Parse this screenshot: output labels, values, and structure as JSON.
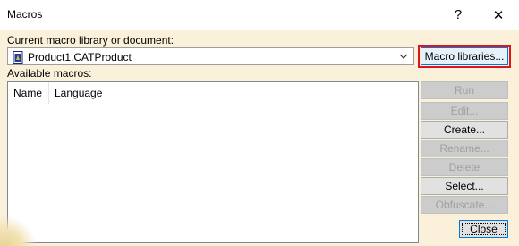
{
  "window": {
    "title": "Macros",
    "help_glyph": "?",
    "close_glyph": "✕"
  },
  "library": {
    "label": "Current macro library or document:",
    "selected": "Product1.CATProduct",
    "icon": "catproduct-document-icon"
  },
  "macros": {
    "label": "Available macros:",
    "columns": [
      "Name",
      "Language"
    ]
  },
  "buttons": {
    "macro_libraries": "Macro libraries...",
    "run": "Run",
    "edit": "Edit...",
    "create": "Create...",
    "rename": "Rename...",
    "delete": "Delete",
    "select": "Select...",
    "obfuscate": "Obfuscate...",
    "close": "Close"
  },
  "colors": {
    "dialog_background": "#fbf0d9",
    "highlight_outline": "#e0151b"
  }
}
